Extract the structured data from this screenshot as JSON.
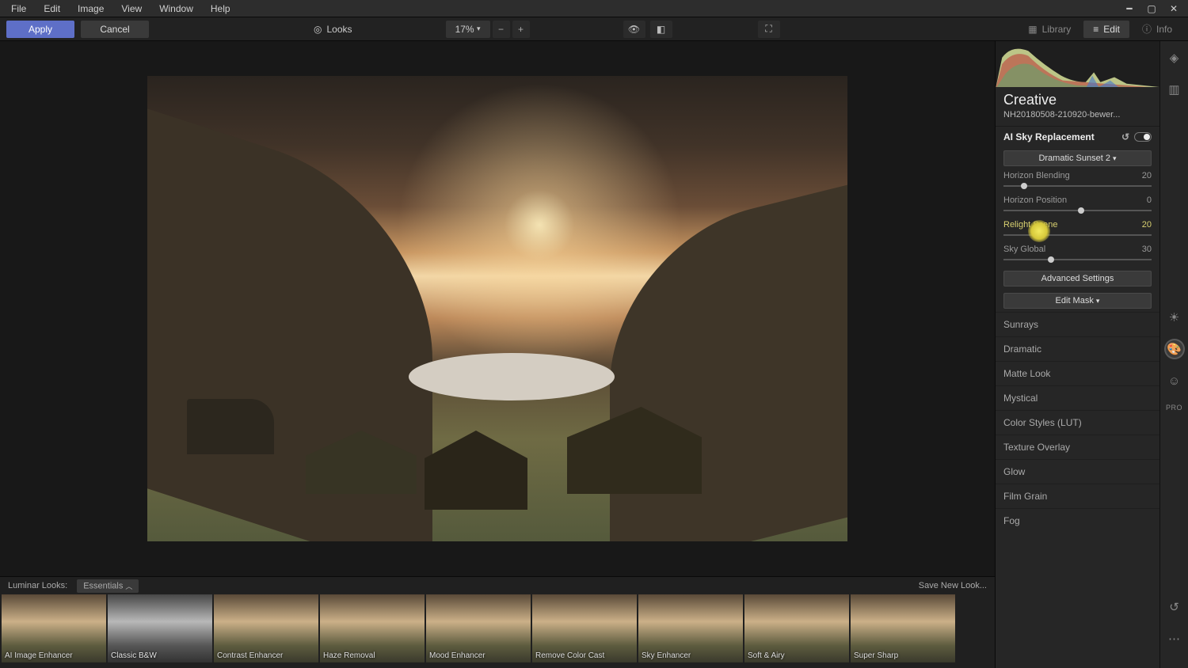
{
  "menu": {
    "file": "File",
    "edit": "Edit",
    "image": "Image",
    "view": "View",
    "window": "Window",
    "help": "Help"
  },
  "toolbar": {
    "apply": "Apply",
    "cancel": "Cancel",
    "looks": "Looks",
    "zoom": "17%",
    "crop": "crop"
  },
  "tabs": {
    "library": "Library",
    "edit": "Edit",
    "info": "Info"
  },
  "panel": {
    "title": "Creative",
    "filename": "NH20180508-210920-bewer...",
    "section": "AI Sky Replacement",
    "preset": "Dramatic Sunset 2",
    "sliders": [
      {
        "label": "Horizon Blending",
        "value": "20",
        "pos": 12
      },
      {
        "label": "Horizon Position",
        "value": "0",
        "pos": 50
      },
      {
        "label": "Relight Scene",
        "value": "20",
        "pos": 22
      },
      {
        "label": "Sky Global",
        "value": "30",
        "pos": 30
      }
    ],
    "adv": "Advanced Settings",
    "mask": "Edit Mask",
    "tools": [
      "Sunrays",
      "Dramatic",
      "Matte Look",
      "Mystical",
      "Color Styles (LUT)",
      "Texture Overlay",
      "Glow",
      "Film Grain",
      "Fog"
    ],
    "pro": "PRO"
  },
  "bottom": {
    "label": "Luminar Looks:",
    "cat": "Essentials",
    "save": "Save New Look...",
    "thumbs": [
      "AI Image Enhancer",
      "Classic B&W",
      "Contrast Enhancer",
      "Haze Removal",
      "Mood Enhancer",
      "Remove Color Cast",
      "Sky Enhancer",
      "Soft & Airy",
      "Super Sharp"
    ]
  }
}
